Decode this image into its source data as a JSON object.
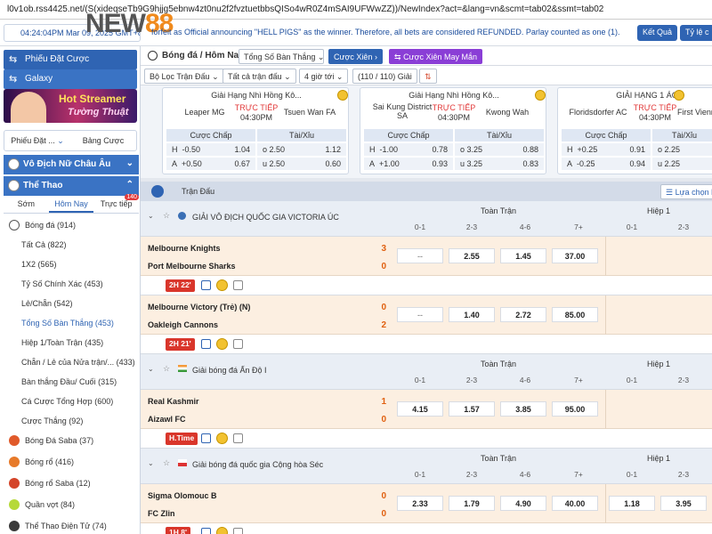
{
  "browser": {
    "url": "l0v1ob.rss4425.net/(S(xideqseTb9G9hjjg5ebnw4zt0nu2f2fvztuetbbsQISo4wR0Z4mSAI9UFWwZZ))/NewIndex?act=&lang=vn&scmt=tab02&ssmt=tab02"
  },
  "header": {
    "datetime": "04:24:04PM Mar 09, 2025 GMT+8",
    "logo_prefix": "NEW",
    "logo_number": "88",
    "ticker": "forfeit as Official announcing \"HELL PIGS\" as the winner. Therefore, all bets are considered REFUNDED. Parlay counted as one (1).",
    "results_label": "Kết Quả",
    "odds_format_label": "Tỷ lệ c"
  },
  "sidebar": {
    "bet_slip_label": "Phiếu Đặt Cược",
    "galaxy_label": "Galaxy",
    "banner_line1": "Hot Streamer",
    "banner_line2": "Tường Thuật",
    "slip_tab": "Phiếu Đặt ...",
    "odds_tab": "Bảng Cược",
    "section_asia": "Vô Địch Nữ Châu Âu",
    "section_sports": "Thể Thao",
    "sub_tabs": [
      "Sớm",
      "Hôm Nay",
      "Trực tiếp"
    ],
    "live_count": "140",
    "items": [
      {
        "label": "Bóng đá",
        "count": "(914)"
      },
      {
        "label": "Tất Cả",
        "count": "(822)"
      },
      {
        "label": "1X2",
        "count": "(565)"
      },
      {
        "label": "Tỷ Số Chính Xác",
        "count": "(453)"
      },
      {
        "label": "Lẻ/Chẵn",
        "count": "(542)"
      },
      {
        "label": "Tổng Số Bàn Thắng",
        "count": "(453)"
      },
      {
        "label": "Hiệp 1/Toàn Trận",
        "count": "(435)"
      },
      {
        "label": "Chẵn / Lẻ của Nửa trận/...",
        "count": "(433)"
      },
      {
        "label": "Bàn thắng Đầu/ Cuối",
        "count": "(315)"
      },
      {
        "label": "Cá Cược Tổng Hợp",
        "count": "(600)"
      },
      {
        "label": "Cược Thắng",
        "count": "(92)"
      },
      {
        "label": "Bóng Đá Saba",
        "count": "(37)"
      },
      {
        "label": "Bóng rổ",
        "count": "(416)"
      },
      {
        "label": "Bóng rổ Saba",
        "count": "(12)"
      },
      {
        "label": "Quần vợt",
        "count": "(84)"
      },
      {
        "label": "Thể Thao Điện Tử",
        "count": "(74)"
      }
    ]
  },
  "main": {
    "title": "Bóng đá / Hôm Nay",
    "title_dropdown": "Tổng Số Bàn Thắng",
    "btn_bet": "Cược Xiên",
    "btn_lucky": "Cược Xiên May Mắn",
    "filter_league": "Bộ Lọc Trận Đấu",
    "filter_all": "Tất cả trận đấu",
    "filter_hours": "4 giờ tới",
    "filter_count": "(110 / 110) Giải",
    "choose_label": "Lựa chọn l"
  },
  "cards": [
    {
      "league": "Giải Hạng Nhì Hồng Kô...",
      "home": "Leaper MG",
      "away": "Tsuen Wan FA",
      "live": "TRỰC TIẾP",
      "time": "04:30PM",
      "hdr1": "Cược Chấp",
      "hdr2": "Tài/Xỉu",
      "r1": {
        "l": "H",
        "h": "-0.50",
        "ho": "1.04",
        "t": "o",
        "tv": "2.50",
        "to": "1.12"
      },
      "r2": {
        "l": "A",
        "h": "+0.50",
        "ho": "0.67",
        "t": "u",
        "tv": "2.50",
        "to": "0.60"
      }
    },
    {
      "league": "Giải Hạng Nhì Hồng Kô...",
      "home": "Sai Kung District SA",
      "away": "Kwong Wah",
      "live": "TRỰC TIẾP",
      "time": "04:30PM",
      "hdr1": "Cược Chấp",
      "hdr2": "Tài/Xỉu",
      "r1": {
        "l": "H",
        "h": "-1.00",
        "ho": "0.78",
        "t": "o",
        "tv": "3.25",
        "to": "0.88"
      },
      "r2": {
        "l": "A",
        "h": "+1.00",
        "ho": "0.93",
        "t": "u",
        "tv": "3.25",
        "to": "0.83"
      }
    },
    {
      "league": "GIẢI HẠNG 1 ÁO",
      "home": "Floridsdorfer AC",
      "away": "First Vienn",
      "live": "TRỰC TIẾP",
      "time": "04:30PM",
      "hdr1": "Cược Chấp",
      "hdr2": "Tài/Xỉu",
      "r1": {
        "l": "H",
        "h": "+0.25",
        "ho": "0.91",
        "t": "o",
        "tv": "2.25",
        "to": ""
      },
      "r2": {
        "l": "A",
        "h": "-0.25",
        "ho": "0.94",
        "t": "u",
        "tv": "2.25",
        "to": ""
      }
    }
  ],
  "odds": {
    "section_title": "Trận Đấu",
    "leagues": [
      {
        "name": "GIẢI VÔ ĐỊCH QUỐC GIA VICTORIA ÚC",
        "full": "Toàn Trận",
        "half": "Hiệp 1",
        "cols": [
          "0-1",
          "2-3",
          "4-6",
          "7+",
          "0-1",
          "2-3"
        ],
        "matches": [
          {
            "home": "Melbourne Knights",
            "away": "Port Melbourne Sharks",
            "hs": "3",
            "as": "0",
            "tag": "2H 22'",
            "odds": [
              "--",
              "2.55",
              "1.45",
              "37.00"
            ]
          },
          {
            "home": "Melbourne Victory (Trẻ) (N)",
            "away": "Oakleigh Cannons",
            "hs": "0",
            "as": "2",
            "tag": "2H 21'",
            "odds": [
              "--",
              "1.40",
              "2.72",
              "85.00"
            ]
          }
        ]
      },
      {
        "name": "Giải bóng đá Ấn Độ I",
        "full": "Toàn Trận",
        "half": "Hiệp 1",
        "cols": [
          "0-1",
          "2-3",
          "4-6",
          "7+",
          "0-1",
          "2-3"
        ],
        "matches": [
          {
            "home": "Real Kashmir",
            "away": "Aizawl FC",
            "hs": "1",
            "as": "0",
            "tag": "H.Time",
            "odds": [
              "4.15",
              "1.57",
              "3.85",
              "95.00"
            ]
          }
        ]
      },
      {
        "name": "Giải bóng đá quốc gia Cộng hòa Séc",
        "full": "Toàn Trận",
        "half": "Hiệp 1",
        "cols": [
          "0-1",
          "2-3",
          "4-6",
          "7+",
          "0-1",
          "2-3"
        ],
        "matches": [
          {
            "home": "Sigma Olomouc B",
            "away": "FC Zlin",
            "hs": "0",
            "as": "0",
            "tag": "1H 8'",
            "odds": [
              "2.33",
              "1.79",
              "4.90",
              "40.00",
              "1.18",
              "3.95"
            ]
          }
        ]
      }
    ]
  },
  "colors": {
    "primary": "#2f64b3",
    "live": "#e23b3b",
    "lucky": "#8a3ed6",
    "score": "#e06010",
    "match_bg": "#fcefe1"
  }
}
